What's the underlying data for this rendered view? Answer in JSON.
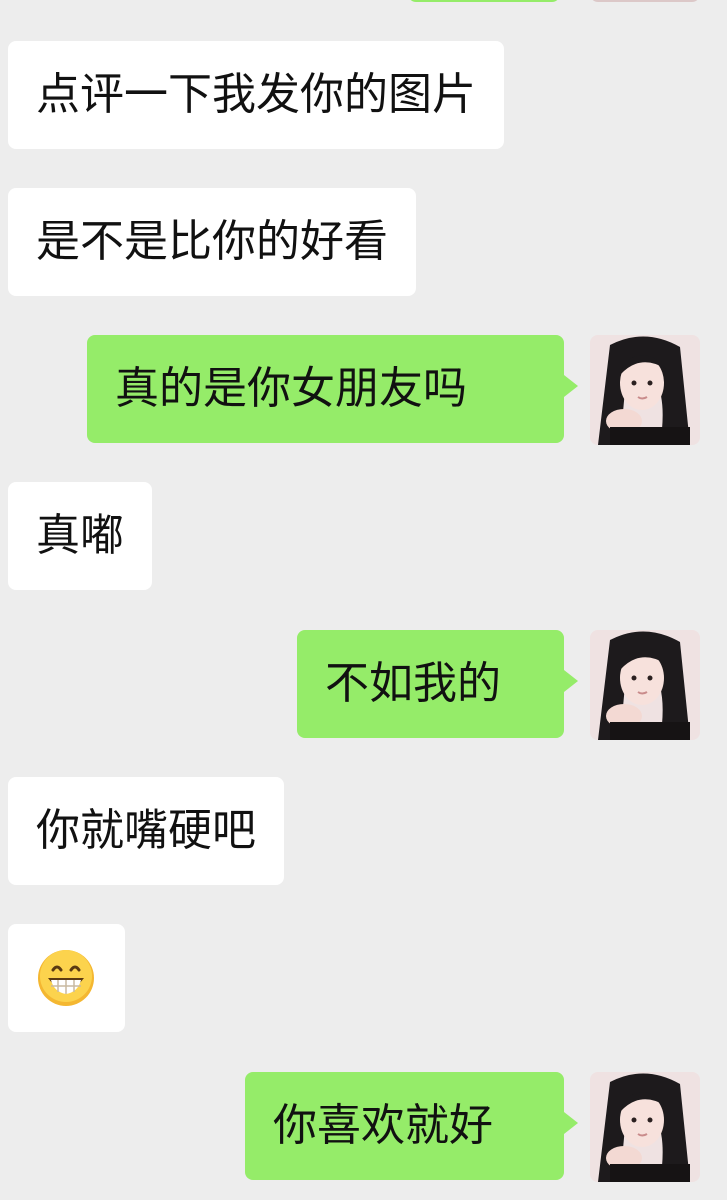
{
  "chat": {
    "messages": [
      {
        "side": "received",
        "text": "点评一下我发你的图片"
      },
      {
        "side": "received",
        "text": "是不是比你的好看"
      },
      {
        "side": "sent",
        "text": "真的是你女朋友吗"
      },
      {
        "side": "received",
        "text": "真嘟"
      },
      {
        "side": "sent",
        "text": "不如我的"
      },
      {
        "side": "received",
        "text": "你就嘴硬吧"
      },
      {
        "side": "received",
        "emoji": "grinning-face-emoji"
      },
      {
        "side": "sent",
        "text": "你喜欢就好"
      }
    ]
  },
  "colors": {
    "background": "#ededed",
    "received_bubble": "#ffffff",
    "sent_bubble": "#95ec69",
    "text": "#111111"
  },
  "icons": [
    "user-avatar",
    "grinning-face-emoji"
  ]
}
